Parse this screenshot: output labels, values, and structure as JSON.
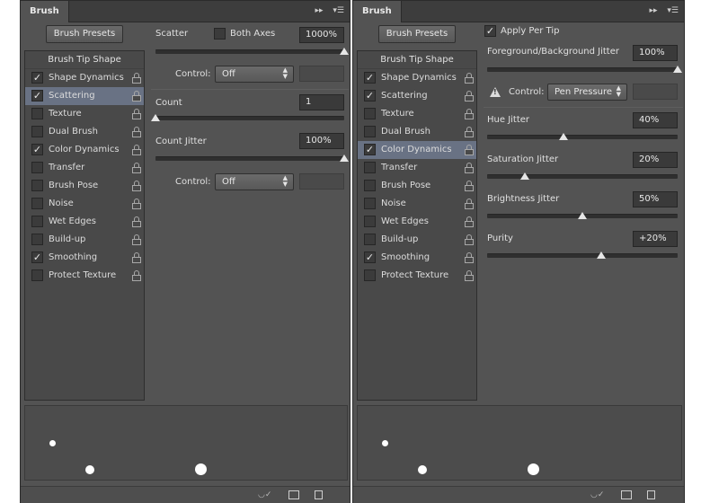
{
  "panel_left": {
    "tab": "Brush",
    "presets_button": "Brush Presets",
    "sidebar": {
      "header": "Brush Tip Shape",
      "items": [
        {
          "label": "Shape Dynamics",
          "checked": "✓"
        },
        {
          "label": "Scattering",
          "checked": "✓"
        },
        {
          "label": "Texture",
          "checked": ""
        },
        {
          "label": "Dual Brush",
          "checked": ""
        },
        {
          "label": "Color Dynamics",
          "checked": "✓"
        },
        {
          "label": "Transfer",
          "checked": ""
        },
        {
          "label": "Brush Pose",
          "checked": ""
        },
        {
          "label": "Noise",
          "checked": ""
        },
        {
          "label": "Wet Edges",
          "checked": ""
        },
        {
          "label": "Build-up",
          "checked": ""
        },
        {
          "label": "Smoothing",
          "checked": "✓"
        },
        {
          "label": "Protect Texture",
          "checked": ""
        }
      ],
      "selected_index": 1
    },
    "scatter": {
      "label": "Scatter",
      "both_axes_label": "Both Axes",
      "value": "1000%",
      "level": 1.0
    },
    "scatter_control": {
      "label": "Control:",
      "value": "Off"
    },
    "count": {
      "label": "Count",
      "value": "1",
      "level": 0.0
    },
    "count_jitter": {
      "label": "Count Jitter",
      "value": "100%",
      "level": 1.0
    },
    "count_control": {
      "label": "Control:",
      "value": "Off"
    }
  },
  "panel_right": {
    "tab": "Brush",
    "presets_button": "Brush Presets",
    "sidebar": {
      "header": "Brush Tip Shape",
      "items": [
        {
          "label": "Shape Dynamics",
          "checked": "✓"
        },
        {
          "label": "Scattering",
          "checked": "✓"
        },
        {
          "label": "Texture",
          "checked": ""
        },
        {
          "label": "Dual Brush",
          "checked": ""
        },
        {
          "label": "Color Dynamics",
          "checked": "✓"
        },
        {
          "label": "Transfer",
          "checked": ""
        },
        {
          "label": "Brush Pose",
          "checked": ""
        },
        {
          "label": "Noise",
          "checked": ""
        },
        {
          "label": "Wet Edges",
          "checked": ""
        },
        {
          "label": "Build-up",
          "checked": ""
        },
        {
          "label": "Smoothing",
          "checked": "✓"
        },
        {
          "label": "Protect Texture",
          "checked": ""
        }
      ],
      "selected_index": 4
    },
    "apply_per_tip": {
      "label": "Apply Per Tip",
      "checked": "✓"
    },
    "fg_bg_jitter": {
      "label": "Foreground/Background Jitter",
      "value": "100%",
      "level": 1.0
    },
    "fg_control": {
      "label": "Control:",
      "value": "Pen Pressure"
    },
    "hue_jitter": {
      "label": "Hue Jitter",
      "value": "40%",
      "level": 0.4
    },
    "saturation_jitter": {
      "label": "Saturation Jitter",
      "value": "20%",
      "level": 0.2
    },
    "brightness_jitter": {
      "label": "Brightness Jitter",
      "value": "50%",
      "level": 0.5
    },
    "purity": {
      "label": "Purity",
      "value": "+20%",
      "level": 0.6
    }
  },
  "icons": {
    "collapse": "double-arrow-icon",
    "menu": "panel-menu-icon",
    "lock": "lock-icon",
    "warning": "warning-icon",
    "protect": "brush-eye-icon",
    "grid": "grid-icon",
    "new": "new-preset-icon"
  },
  "colors": {
    "panel_bg": "#535353",
    "selected_row": "#697284"
  }
}
